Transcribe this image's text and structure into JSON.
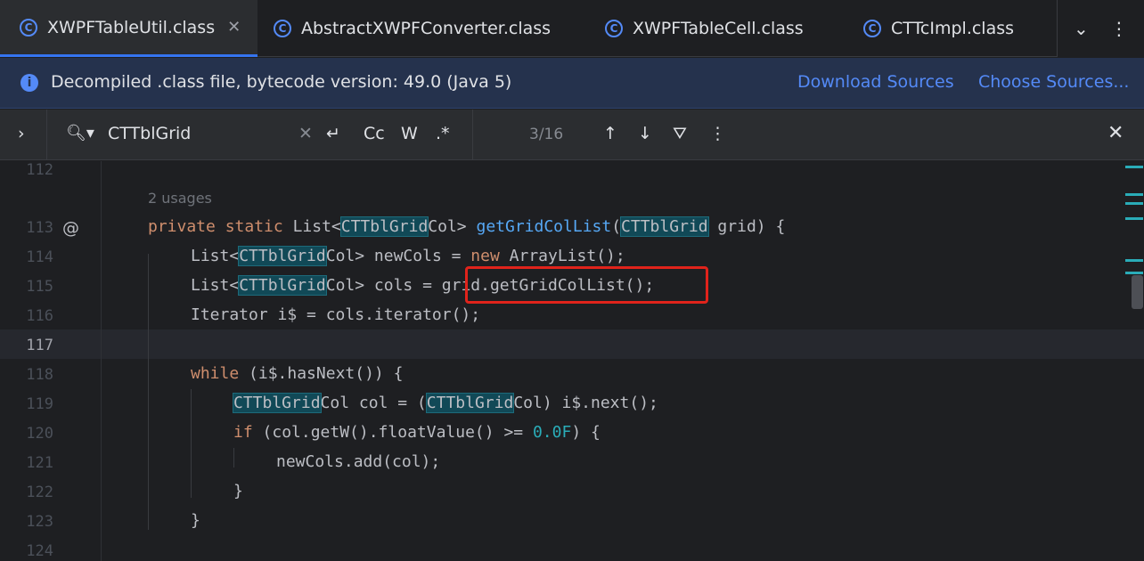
{
  "tabs": [
    {
      "label": "XWPFTableUtil.class",
      "active": true,
      "closable": true
    },
    {
      "label": "AbstractXWPFConverter.class",
      "active": false
    },
    {
      "label": "XWPFTableCell.class",
      "active": false
    },
    {
      "label": "CTTcImpl.class",
      "active": false
    }
  ],
  "tab_actions": {
    "more_tabs_icon": "chevron-down-icon",
    "menu_icon": "vertical-dots-icon"
  },
  "banner": {
    "text": "Decompiled .class file, bytecode version: 49.0 (Java 5)",
    "download_sources": "Download Sources",
    "choose_sources": "Choose Sources..."
  },
  "find": {
    "query": "CTTblGrid",
    "match_case": "Cc",
    "words": "W",
    "regex": ".*",
    "counter": "3/16"
  },
  "editor": {
    "lines": [
      "112",
      "113",
      "114",
      "115",
      "116",
      "117",
      "118",
      "119",
      "120",
      "121",
      "122",
      "123",
      "124"
    ],
    "usages_hint": "2 usages",
    "current_line": "117"
  },
  "colors": {
    "accent": "#3574f0",
    "link": "#548af7",
    "keyword": "#cf8e6d",
    "function": "#56a8f5",
    "number": "#2aacb8",
    "search_highlight": "#114957",
    "annotation_box": "#e0231b"
  }
}
